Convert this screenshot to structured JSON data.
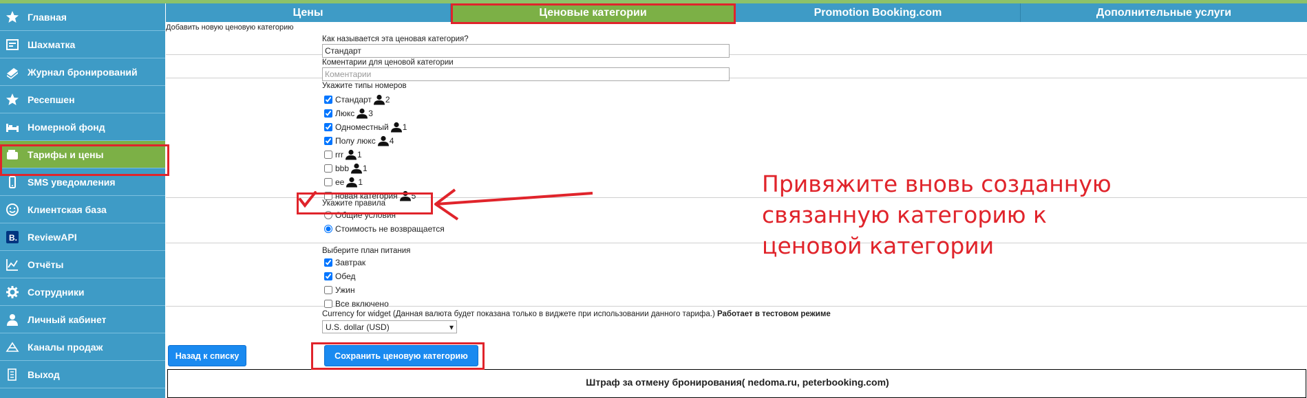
{
  "sidebar": {
    "items": [
      {
        "label": "Главная",
        "icon": "star-icon"
      },
      {
        "label": "Шахматка",
        "icon": "grid-icon"
      },
      {
        "label": "Журнал бронирований",
        "icon": "book-icon"
      },
      {
        "label": "Ресепшен",
        "icon": "star-icon"
      },
      {
        "label": "Номерной фонд",
        "icon": "bed-icon"
      },
      {
        "label": "Тарифы и цены",
        "icon": "wallet-icon"
      },
      {
        "label": "SMS уведомления",
        "icon": "phone-icon"
      },
      {
        "label": "Клиентская база",
        "icon": "smile-icon"
      },
      {
        "label": "ReviewAPI",
        "icon": "booking-icon"
      },
      {
        "label": "Отчёты",
        "icon": "chart-icon"
      },
      {
        "label": "Сотрудники",
        "icon": "gear-icon"
      },
      {
        "label": "Личный кабинет",
        "icon": "user-icon"
      },
      {
        "label": "Каналы продаж",
        "icon": "channel-icon"
      },
      {
        "label": "Выход",
        "icon": "exit-icon"
      }
    ],
    "active_index": 5
  },
  "tabs": [
    {
      "label": "Цены"
    },
    {
      "label": "Ценовые категории"
    },
    {
      "label": "Promotion Booking.com"
    },
    {
      "label": "Дополнительные услуги"
    }
  ],
  "form": {
    "add_title": "Добавить новую ценовую категорию",
    "name_label": "Как называется эта ценовая категория?",
    "name_value": "Стандарт",
    "comment_label": "Коментарии для ценовой категории",
    "comment_placeholder": "Коментарии",
    "room_types_label": "Укажите типы номеров",
    "room_types": [
      {
        "name": "Стандарт",
        "capacity": "2",
        "checked": true
      },
      {
        "name": "Люкс",
        "capacity": "3",
        "checked": true
      },
      {
        "name": "Одноместный",
        "capacity": "1",
        "checked": true
      },
      {
        "name": "Полу люкс",
        "capacity": "4",
        "checked": true
      },
      {
        "name": "rrr",
        "capacity": "1",
        "checked": false
      },
      {
        "name": "bbb",
        "capacity": "1",
        "checked": false
      },
      {
        "name": "ee",
        "capacity": "1",
        "checked": false
      },
      {
        "name": "новая категория",
        "capacity": "5",
        "checked": false
      }
    ],
    "rules_label": "Укажите правила",
    "rules": [
      {
        "label": "Общие условия",
        "selected": false
      },
      {
        "label": "Стоимость не возвращается",
        "selected": true
      }
    ],
    "meal_label": "Выберите план питания",
    "meals": [
      {
        "label": "Завтрак",
        "checked": true
      },
      {
        "label": "Обед",
        "checked": true
      },
      {
        "label": "Ужин",
        "checked": false
      },
      {
        "label": "Все включено",
        "checked": false
      }
    ],
    "currency_label": "Currency for widget",
    "currency_note": " (Данная валюта будет показана только в виджете при использовании данного тарифа.) ",
    "currency_test": "Работает в тестовом режиме",
    "currency_value": "U.S. dollar (USD)",
    "back_button": "Назад к списку",
    "save_button": "Сохранить ценовую категорию",
    "penalty_title": "Штраф за отмену бронирования( nedoma.ru, peterbooking.com)"
  },
  "annotation": {
    "text": "Привяжите вновь созданную связанную категорию к ценовой категории",
    "line1": "Привяжите вновь созданную",
    "line2": "связанную категорию к",
    "line3": "ценовой категории",
    "color": "#e0242b"
  },
  "colors": {
    "sidebar_bg": "#3e9bc6",
    "active_green": "#7cb046",
    "button_blue": "#1a8af0",
    "annotation_red": "#e0242b"
  }
}
